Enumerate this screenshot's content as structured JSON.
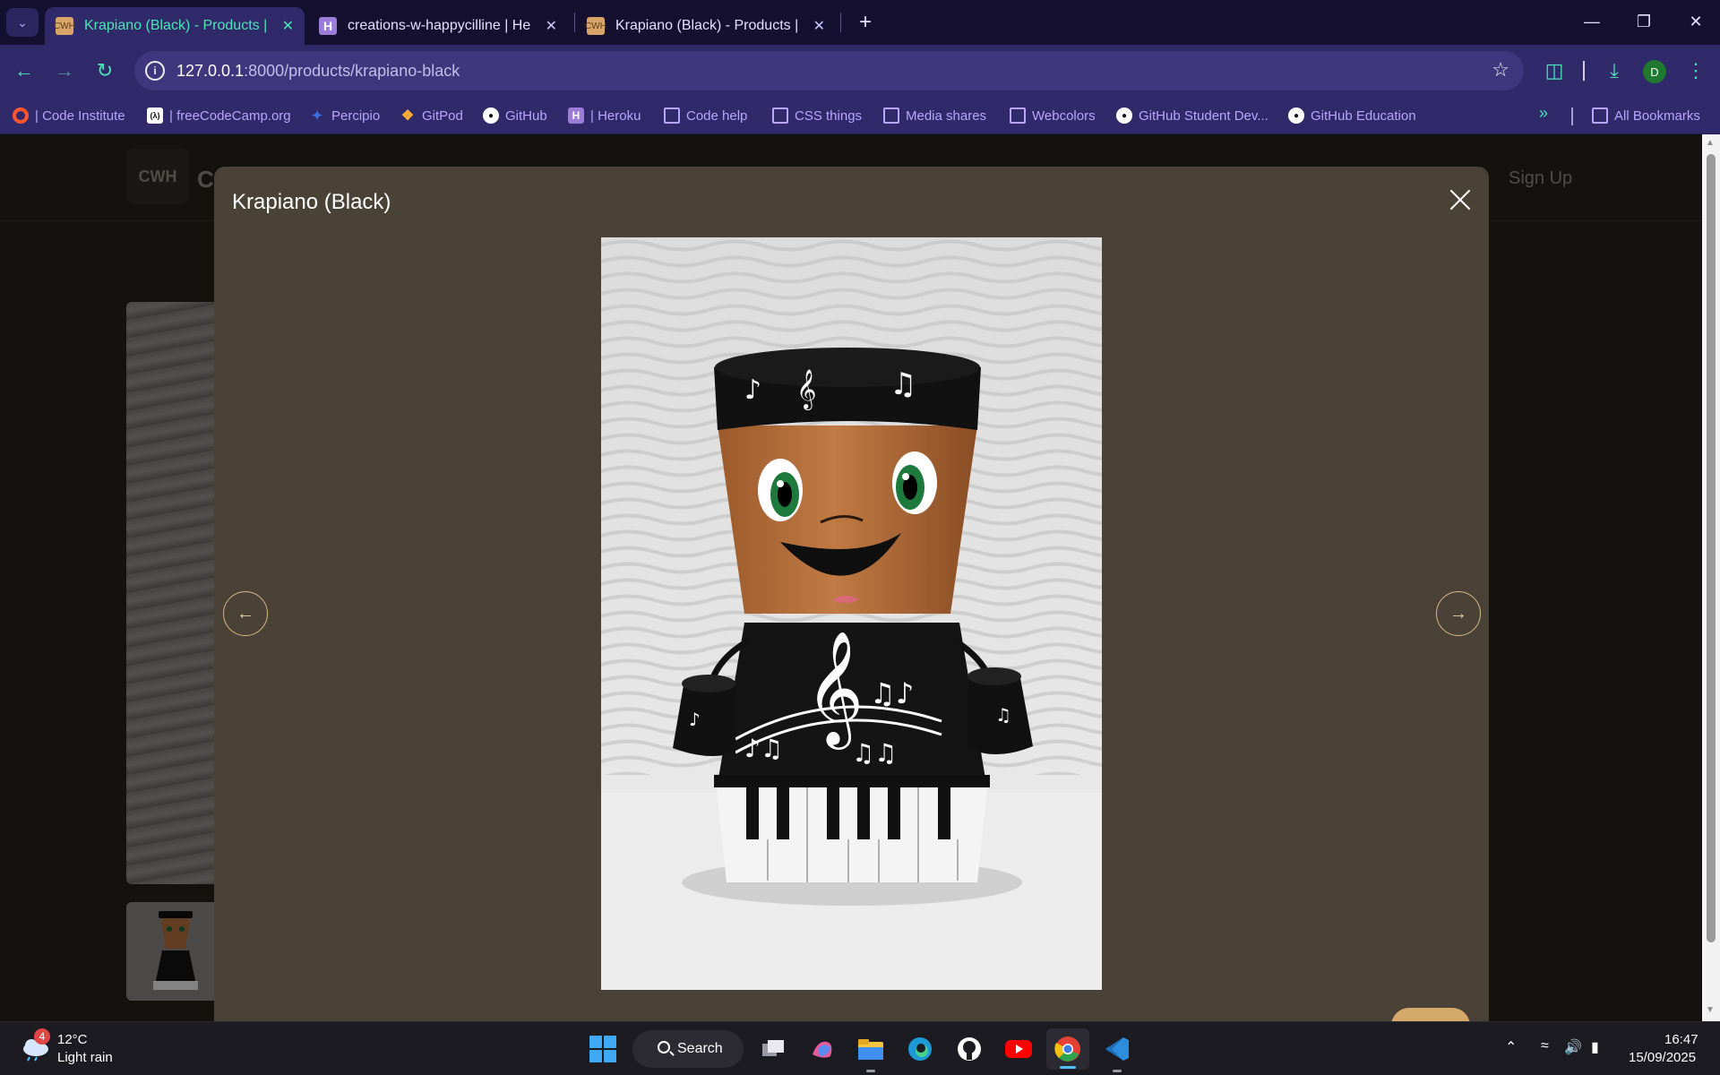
{
  "browser": {
    "tabs": [
      {
        "title": "Krapiano (Black) - Products | Cr",
        "favicon": "CWH",
        "active": true
      },
      {
        "title": "creations-w-happycilline | Hero",
        "favicon": "H",
        "active": false
      },
      {
        "title": "Krapiano (Black) - Products | Cr",
        "favicon": "CWH",
        "active": false
      }
    ],
    "url_host": "127.0.0.1",
    "url_path": ":8000/products/krapiano-black",
    "profile_initial": "D",
    "bookmarks": [
      {
        "label": "| Code Institute",
        "icon": "code-institute-icon"
      },
      {
        "label": "| freeCodeCamp.org",
        "icon": "freecodecamp-icon"
      },
      {
        "label": "Percipio",
        "icon": "percipio-icon"
      },
      {
        "label": "GitPod",
        "icon": "gitpod-icon"
      },
      {
        "label": "GitHub",
        "icon": "github-icon"
      },
      {
        "label": "| Heroku",
        "icon": "heroku-icon"
      },
      {
        "label": "Code help",
        "icon": "folder-icon"
      },
      {
        "label": "CSS things",
        "icon": "folder-icon"
      },
      {
        "label": "Media shares",
        "icon": "folder-icon"
      },
      {
        "label": "Webcolors",
        "icon": "folder-icon"
      },
      {
        "label": "GitHub Student Dev...",
        "icon": "github-icon"
      },
      {
        "label": "GitHub Education",
        "icon": "github-icon"
      }
    ],
    "all_bookmarks": "All Bookmarks",
    "accent": "#4de3b7"
  },
  "site": {
    "brand_initial": "C",
    "signup": "Sign Up"
  },
  "modal": {
    "title": "Krapiano (Black)",
    "prev": "←",
    "next": "→"
  },
  "taskbar": {
    "weather_badge": "4",
    "weather_temp": "12°C",
    "weather_desc": "Light rain",
    "search_label": "Search",
    "time": "16:47",
    "date": "15/09/2025"
  }
}
